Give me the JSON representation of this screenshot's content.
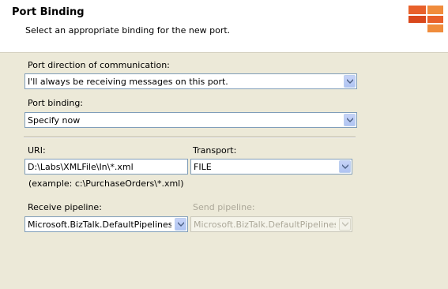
{
  "header": {
    "title": "Port Binding",
    "subtitle": "Select an appropriate binding for the new port."
  },
  "logo": {
    "icon": "orange-grid-logo-icon",
    "colors": [
      "#e8602a",
      "#f08c3c",
      "#d9481c"
    ]
  },
  "direction": {
    "label": "Port direction of communication:",
    "value": "I'll always be receiving messages on this port."
  },
  "binding": {
    "label": "Port binding:",
    "value": "Specify now"
  },
  "uri": {
    "label": "URI:",
    "value": "D:\\Labs\\XMLFile\\In\\*.xml",
    "example": "(example: c:\\PurchaseOrders\\*.xml)"
  },
  "transport": {
    "label": "Transport:",
    "value": "FILE"
  },
  "receive_pipeline": {
    "label": "Receive pipeline:",
    "value": "Microsoft.BizTalk.DefaultPipelines.XML"
  },
  "send_pipeline": {
    "label": "Send pipeline:",
    "value": "Microsoft.BizTalk.DefaultPipelines.XML"
  }
}
